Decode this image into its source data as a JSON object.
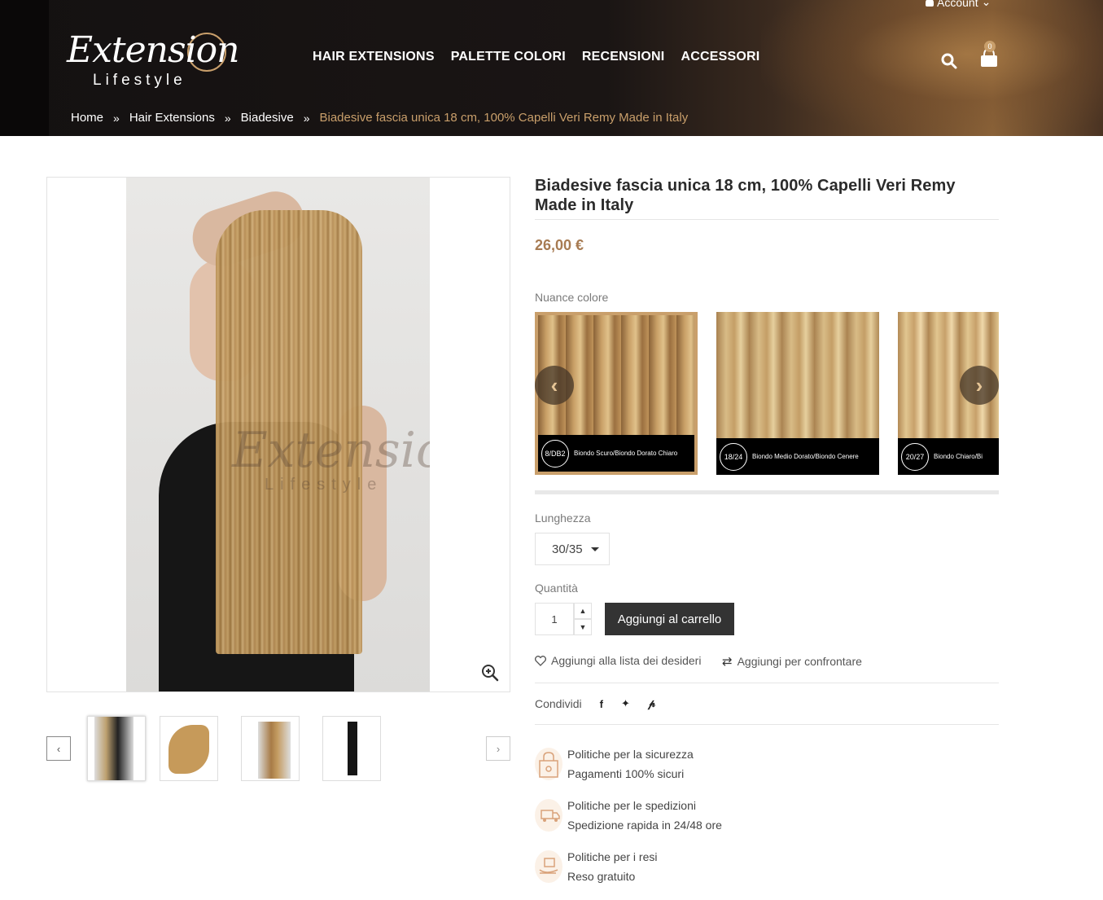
{
  "header": {
    "account_label": "Account",
    "logo": {
      "script": "Extension",
      "sub": "Lifestyle"
    },
    "nav": [
      "HAIR EXTENSIONS",
      "PALETTE COLORI",
      "RECENSIONI",
      "ACCESSORI"
    ],
    "cart_count": "0",
    "breadcrumb": [
      "Home",
      "Hair Extensions",
      "Biadesive",
      "Biadesive fascia unica 18 cm, 100% Capelli Veri Remy Made in Italy"
    ]
  },
  "gallery": {
    "watermark": "Extension",
    "watermark_sub": "Lifestyle",
    "thumb_prev": "‹",
    "thumb_next": "›"
  },
  "product": {
    "title": "Biadesive fascia unica 18 cm, 100% Capelli Veri Remy Made in Italy",
    "price": "26,00 €",
    "shade_label": "Nuance colore",
    "shades": [
      {
        "code": "8/DB2",
        "name": "Biondo Scuro/Biondo Dorato Chiaro"
      },
      {
        "code": "18/24",
        "name": "Biondo Medio Dorato/Biondo Cenere"
      },
      {
        "code": "20/27",
        "name": "Biondo Chiaro/Bi"
      }
    ],
    "length_label": "Lunghezza",
    "length_value": "30/35",
    "qty_label": "Quantità",
    "qty_value": "1",
    "add_to_cart": "Aggiungi al carrello",
    "wishlist": "Aggiungi alla lista dei desideri",
    "compare": "Aggiungi per confrontare",
    "share_label": "Condividi"
  },
  "policies": [
    {
      "title": "Politiche per la sicurezza",
      "desc": "Pagamenti 100% sicuri"
    },
    {
      "title": "Politiche per le spedizioni",
      "desc": "Spedizione rapida in 24/48 ore"
    },
    {
      "title": "Politiche per i resi",
      "desc": "Reso gratuito"
    }
  ],
  "colors": {
    "accent": "#c99f6b",
    "price": "#a77b52",
    "button": "#333333"
  }
}
